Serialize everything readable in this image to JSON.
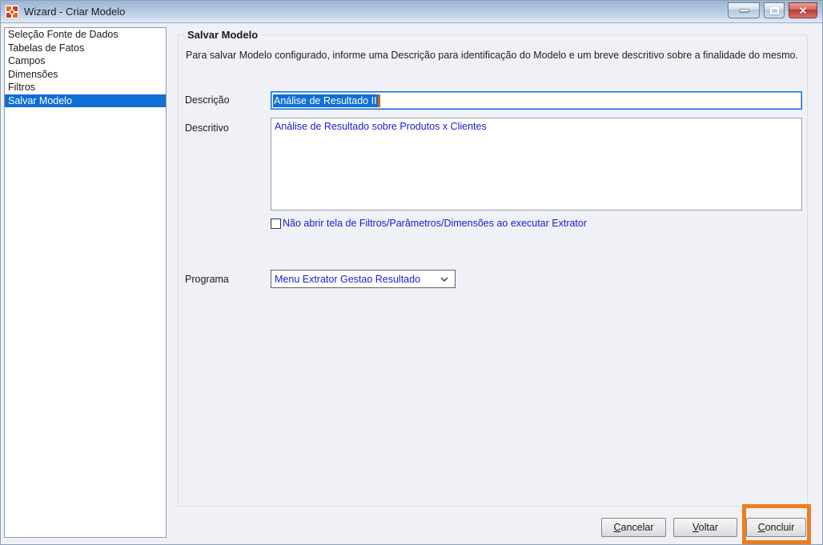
{
  "titlebar": {
    "title": "Wizard - Criar Modelo",
    "icons": {
      "app": "app-icon",
      "minimize": "minimize-icon",
      "maximize": "maximize-icon",
      "close": "close-icon"
    },
    "close_glyph": "✕"
  },
  "sidebar": {
    "items": [
      {
        "label": "Seleção Fonte de Dados",
        "selected": false
      },
      {
        "label": "Tabelas de Fatos",
        "selected": false
      },
      {
        "label": "Campos",
        "selected": false
      },
      {
        "label": "Dimensões",
        "selected": false
      },
      {
        "label": "Filtros",
        "selected": false
      },
      {
        "label": "Salvar Modelo",
        "selected": true
      }
    ]
  },
  "main": {
    "group_title": "Salvar Modelo",
    "instructions": "Para salvar Modelo configurado, informe uma Descrição para identificação do Modelo e um breve descritivo sobre a finalidade do mesmo.",
    "fields": {
      "descricao": {
        "label": "Descrição",
        "value": "Análise de Resultado II",
        "text_selected": true
      },
      "descritivo": {
        "label": "Descritivo",
        "value": "Análise de Resultado sobre Produtos x Clientes"
      },
      "no_open_checkbox": {
        "label": "Não abrir tela de Filtros/Parâmetros/Dimensões ao executar Extrator",
        "checked": false
      },
      "programa": {
        "label": "Programa",
        "value": "Menu Extrator Gestao Resultado"
      }
    }
  },
  "footer": {
    "buttons": [
      {
        "label": "Cancelar",
        "highlighted": false
      },
      {
        "label": "Voltar",
        "highlighted": false
      },
      {
        "label": "Concluir",
        "highlighted": true
      }
    ]
  },
  "colors": {
    "selection_blue": "#0f6fd7",
    "field_text_blue": "#1b1bd1",
    "annotation_orange": "#ee7d1e",
    "close_button_red": "#b93a32",
    "titlebar_blue": "#b4c8e1",
    "dialog_background": "#f0f1f6"
  }
}
